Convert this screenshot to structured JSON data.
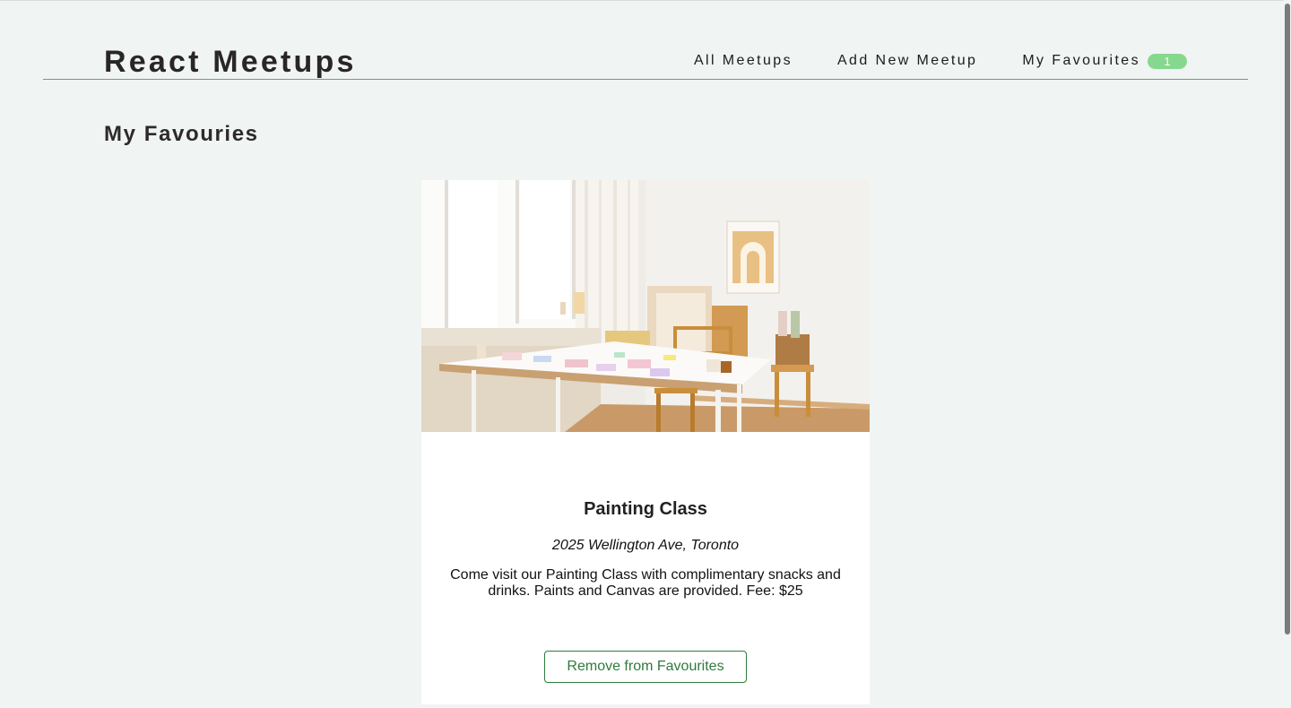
{
  "header": {
    "logo": "React Meetups",
    "nav": [
      {
        "label": "All Meetups"
      },
      {
        "label": "Add New Meetup"
      },
      {
        "label": "My Favourites",
        "badge": "1"
      }
    ]
  },
  "main": {
    "title": "My Favouries"
  },
  "card": {
    "image_alt": "Painting Class",
    "title": "Painting Class",
    "address": "2025 Wellington Ave, Toronto",
    "description": "Come visit our Painting Class with complimentary snacks and drinks. Paints and Canvas are provided. Fee: $25",
    "button_label": "Remove from Favourites"
  },
  "colors": {
    "page_background": "#f0f4f3",
    "badge_background": "#86d88f",
    "button_accent": "#2f7a3e"
  }
}
